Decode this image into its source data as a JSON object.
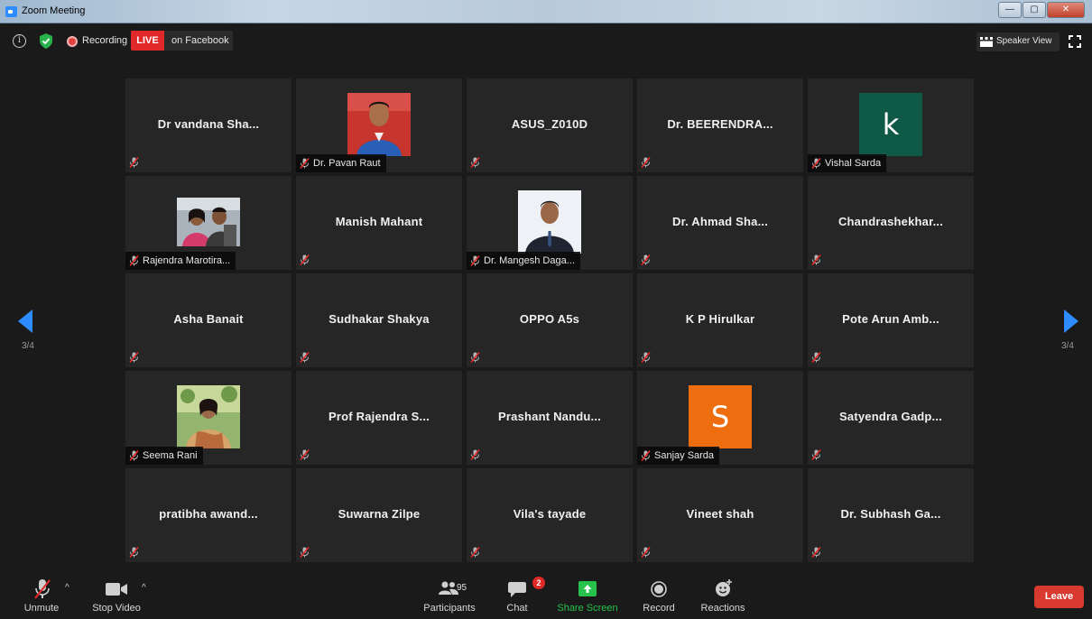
{
  "window": {
    "title": "Zoom Meeting",
    "controls": {
      "minimize": "—",
      "maximize": "▢",
      "close": "✕"
    }
  },
  "topbar": {
    "info_glyph": "i",
    "recording_label": "Recording",
    "live_label": "LIVE",
    "live_destination": "on Facebook",
    "view_label": "Speaker View"
  },
  "paging": {
    "left_page": "3/4",
    "right_page": "3/4"
  },
  "participants": [
    {
      "name": "Dr vandana Sha...",
      "kind": "text"
    },
    {
      "name": "Dr. Pavan Raut",
      "kind": "photo",
      "photo": "pavan"
    },
    {
      "name": "ASUS_Z010D",
      "kind": "text"
    },
    {
      "name": "Dr. BEERENDRA...",
      "kind": "text"
    },
    {
      "name": "Vishal Sarda",
      "kind": "letter",
      "letter": "k",
      "color": "#0f5a47"
    },
    {
      "name": "Rajendra Marotira...",
      "kind": "photo",
      "photo": "rajendra"
    },
    {
      "name": "Manish Mahant",
      "kind": "text"
    },
    {
      "name": "Dr. Mangesh Daga...",
      "kind": "photo",
      "photo": "mangesh"
    },
    {
      "name": "Dr. Ahmad Sha...",
      "kind": "text"
    },
    {
      "name": "Chandrashekhar...",
      "kind": "text"
    },
    {
      "name": "Asha Banait",
      "kind": "text"
    },
    {
      "name": "Sudhakar Shakya",
      "kind": "text"
    },
    {
      "name": "OPPO A5s",
      "kind": "text"
    },
    {
      "name": "K P Hirulkar",
      "kind": "text"
    },
    {
      "name": "Pote Arun Amb...",
      "kind": "text"
    },
    {
      "name": "Seema Rani",
      "kind": "photo",
      "photo": "seema"
    },
    {
      "name": "Prof Rajendra S...",
      "kind": "text"
    },
    {
      "name": "Prashant  Nandu...",
      "kind": "text"
    },
    {
      "name": "Sanjay Sarda",
      "kind": "letter",
      "letter": "S",
      "color": "#ee6d0e"
    },
    {
      "name": "Satyendra  Gadp...",
      "kind": "text"
    },
    {
      "name": "pratibha  awand...",
      "kind": "text"
    },
    {
      "name": "Suwarna Zilpe",
      "kind": "text"
    },
    {
      "name": "Vila's tayade",
      "kind": "text"
    },
    {
      "name": "Vineet shah",
      "kind": "text"
    },
    {
      "name": "Dr. Subhash Ga...",
      "kind": "text"
    }
  ],
  "toolbar": {
    "unmute_label": "Unmute",
    "stop_video_label": "Stop Video",
    "participants_label": "Participants",
    "participants_count": "95",
    "chat_label": "Chat",
    "chat_badge": "2",
    "share_label": "Share Screen",
    "record_label": "Record",
    "reactions_label": "Reactions",
    "leave_label": "Leave",
    "caret": "^"
  },
  "colors": {
    "accent_blue": "#2d8cff",
    "live_red": "#e02828",
    "share_green": "#27c24c",
    "leave_red": "#d93a2f",
    "tile_bg": "#262626"
  }
}
